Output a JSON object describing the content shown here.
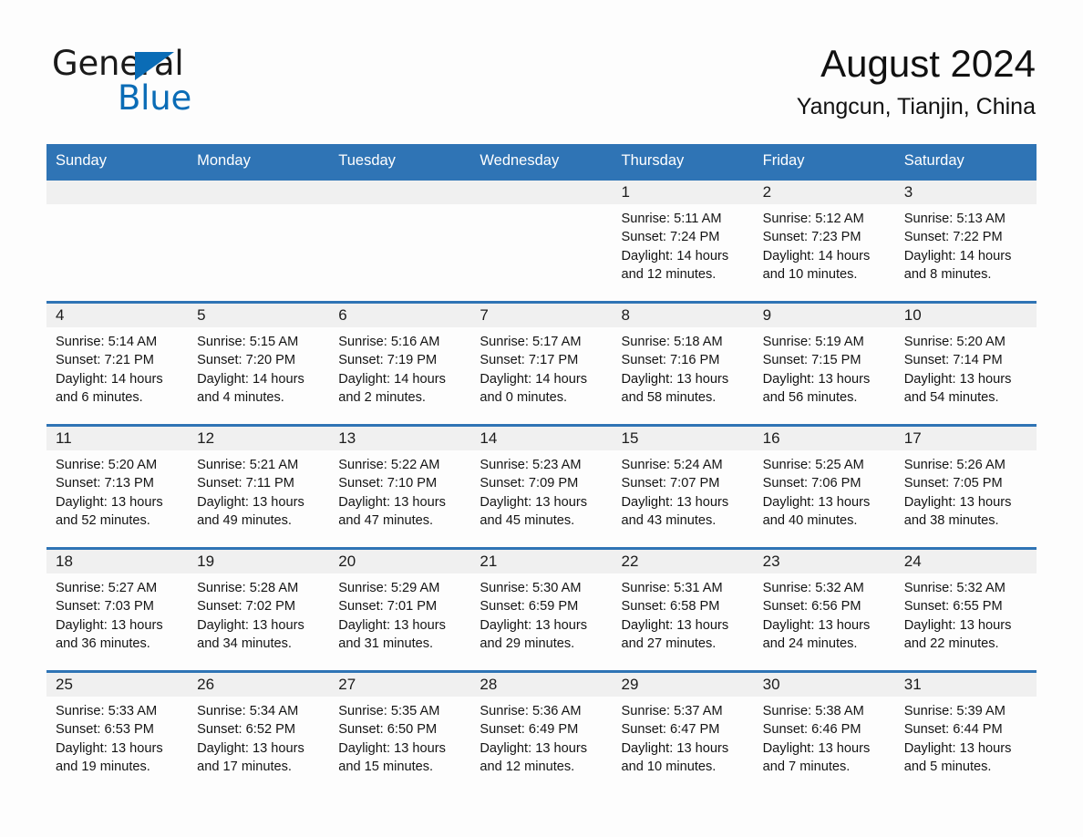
{
  "brand": {
    "name_part1": "General",
    "name_part2": "Blue",
    "triangle_color": "#0a6cb6",
    "text_color": "#1a1a1a"
  },
  "header": {
    "month_title": "August 2024",
    "location": "Yangcun, Tianjin, China"
  },
  "theme": {
    "header_blue": "#2f74b5",
    "daynum_band": "#f0f0f0",
    "page_background": "#fdfdfd"
  },
  "calendar": {
    "weekday_headers": [
      "Sunday",
      "Monday",
      "Tuesday",
      "Wednesday",
      "Thursday",
      "Friday",
      "Saturday"
    ],
    "weeks": [
      [
        {
          "day": "",
          "lines": []
        },
        {
          "day": "",
          "lines": []
        },
        {
          "day": "",
          "lines": []
        },
        {
          "day": "",
          "lines": []
        },
        {
          "day": "1",
          "lines": [
            "Sunrise: 5:11 AM",
            "Sunset: 7:24 PM",
            "Daylight: 14 hours",
            "and 12 minutes."
          ]
        },
        {
          "day": "2",
          "lines": [
            "Sunrise: 5:12 AM",
            "Sunset: 7:23 PM",
            "Daylight: 14 hours",
            "and 10 minutes."
          ]
        },
        {
          "day": "3",
          "lines": [
            "Sunrise: 5:13 AM",
            "Sunset: 7:22 PM",
            "Daylight: 14 hours",
            "and 8 minutes."
          ]
        }
      ],
      [
        {
          "day": "4",
          "lines": [
            "Sunrise: 5:14 AM",
            "Sunset: 7:21 PM",
            "Daylight: 14 hours",
            "and 6 minutes."
          ]
        },
        {
          "day": "5",
          "lines": [
            "Sunrise: 5:15 AM",
            "Sunset: 7:20 PM",
            "Daylight: 14 hours",
            "and 4 minutes."
          ]
        },
        {
          "day": "6",
          "lines": [
            "Sunrise: 5:16 AM",
            "Sunset: 7:19 PM",
            "Daylight: 14 hours",
            "and 2 minutes."
          ]
        },
        {
          "day": "7",
          "lines": [
            "Sunrise: 5:17 AM",
            "Sunset: 7:17 PM",
            "Daylight: 14 hours",
            "and 0 minutes."
          ]
        },
        {
          "day": "8",
          "lines": [
            "Sunrise: 5:18 AM",
            "Sunset: 7:16 PM",
            "Daylight: 13 hours",
            "and 58 minutes."
          ]
        },
        {
          "day": "9",
          "lines": [
            "Sunrise: 5:19 AM",
            "Sunset: 7:15 PM",
            "Daylight: 13 hours",
            "and 56 minutes."
          ]
        },
        {
          "day": "10",
          "lines": [
            "Sunrise: 5:20 AM",
            "Sunset: 7:14 PM",
            "Daylight: 13 hours",
            "and 54 minutes."
          ]
        }
      ],
      [
        {
          "day": "11",
          "lines": [
            "Sunrise: 5:20 AM",
            "Sunset: 7:13 PM",
            "Daylight: 13 hours",
            "and 52 minutes."
          ]
        },
        {
          "day": "12",
          "lines": [
            "Sunrise: 5:21 AM",
            "Sunset: 7:11 PM",
            "Daylight: 13 hours",
            "and 49 minutes."
          ]
        },
        {
          "day": "13",
          "lines": [
            "Sunrise: 5:22 AM",
            "Sunset: 7:10 PM",
            "Daylight: 13 hours",
            "and 47 minutes."
          ]
        },
        {
          "day": "14",
          "lines": [
            "Sunrise: 5:23 AM",
            "Sunset: 7:09 PM",
            "Daylight: 13 hours",
            "and 45 minutes."
          ]
        },
        {
          "day": "15",
          "lines": [
            "Sunrise: 5:24 AM",
            "Sunset: 7:07 PM",
            "Daylight: 13 hours",
            "and 43 minutes."
          ]
        },
        {
          "day": "16",
          "lines": [
            "Sunrise: 5:25 AM",
            "Sunset: 7:06 PM",
            "Daylight: 13 hours",
            "and 40 minutes."
          ]
        },
        {
          "day": "17",
          "lines": [
            "Sunrise: 5:26 AM",
            "Sunset: 7:05 PM",
            "Daylight: 13 hours",
            "and 38 minutes."
          ]
        }
      ],
      [
        {
          "day": "18",
          "lines": [
            "Sunrise: 5:27 AM",
            "Sunset: 7:03 PM",
            "Daylight: 13 hours",
            "and 36 minutes."
          ]
        },
        {
          "day": "19",
          "lines": [
            "Sunrise: 5:28 AM",
            "Sunset: 7:02 PM",
            "Daylight: 13 hours",
            "and 34 minutes."
          ]
        },
        {
          "day": "20",
          "lines": [
            "Sunrise: 5:29 AM",
            "Sunset: 7:01 PM",
            "Daylight: 13 hours",
            "and 31 minutes."
          ]
        },
        {
          "day": "21",
          "lines": [
            "Sunrise: 5:30 AM",
            "Sunset: 6:59 PM",
            "Daylight: 13 hours",
            "and 29 minutes."
          ]
        },
        {
          "day": "22",
          "lines": [
            "Sunrise: 5:31 AM",
            "Sunset: 6:58 PM",
            "Daylight: 13 hours",
            "and 27 minutes."
          ]
        },
        {
          "day": "23",
          "lines": [
            "Sunrise: 5:32 AM",
            "Sunset: 6:56 PM",
            "Daylight: 13 hours",
            "and 24 minutes."
          ]
        },
        {
          "day": "24",
          "lines": [
            "Sunrise: 5:32 AM",
            "Sunset: 6:55 PM",
            "Daylight: 13 hours",
            "and 22 minutes."
          ]
        }
      ],
      [
        {
          "day": "25",
          "lines": [
            "Sunrise: 5:33 AM",
            "Sunset: 6:53 PM",
            "Daylight: 13 hours",
            "and 19 minutes."
          ]
        },
        {
          "day": "26",
          "lines": [
            "Sunrise: 5:34 AM",
            "Sunset: 6:52 PM",
            "Daylight: 13 hours",
            "and 17 minutes."
          ]
        },
        {
          "day": "27",
          "lines": [
            "Sunrise: 5:35 AM",
            "Sunset: 6:50 PM",
            "Daylight: 13 hours",
            "and 15 minutes."
          ]
        },
        {
          "day": "28",
          "lines": [
            "Sunrise: 5:36 AM",
            "Sunset: 6:49 PM",
            "Daylight: 13 hours",
            "and 12 minutes."
          ]
        },
        {
          "day": "29",
          "lines": [
            "Sunrise: 5:37 AM",
            "Sunset: 6:47 PM",
            "Daylight: 13 hours",
            "and 10 minutes."
          ]
        },
        {
          "day": "30",
          "lines": [
            "Sunrise: 5:38 AM",
            "Sunset: 6:46 PM",
            "Daylight: 13 hours",
            "and 7 minutes."
          ]
        },
        {
          "day": "31",
          "lines": [
            "Sunrise: 5:39 AM",
            "Sunset: 6:44 PM",
            "Daylight: 13 hours",
            "and 5 minutes."
          ]
        }
      ]
    ]
  }
}
